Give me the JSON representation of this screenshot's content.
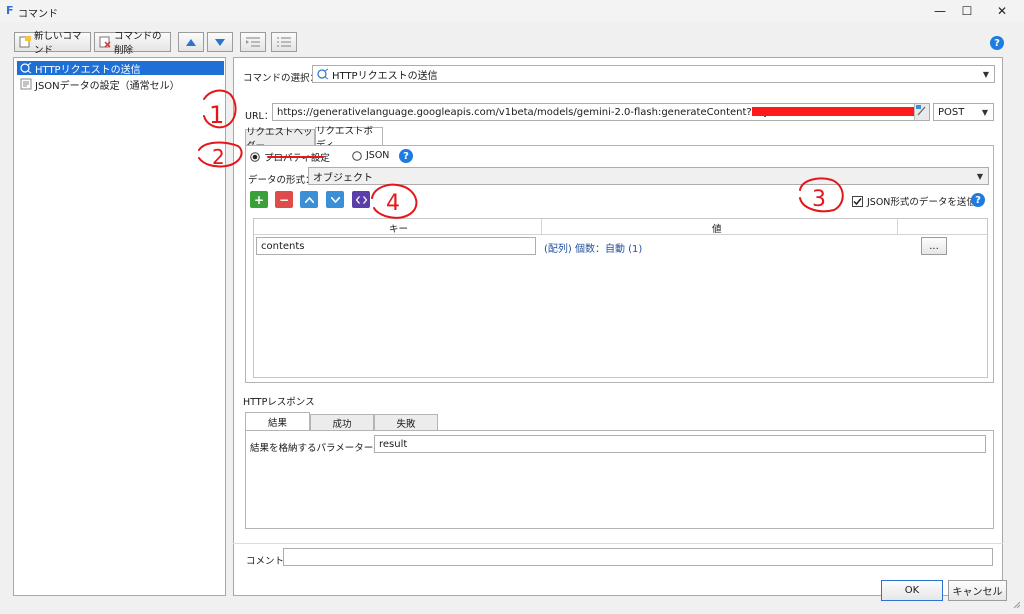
{
  "window": {
    "logo": "F",
    "title": "コマンド",
    "minimize": "—",
    "maximize": "☐",
    "close": "✕"
  },
  "toolbar": {
    "new_command": "新しいコマンド",
    "delete_command": "コマンドの削除",
    "up_icon": "triangle-up",
    "down_icon": "triangle-down",
    "help": "?"
  },
  "tree": {
    "items": [
      {
        "label": "HTTPリクエストの送信",
        "selected": true
      },
      {
        "label": "JSONデータの設定（通常セル）",
        "selected": false
      }
    ]
  },
  "command_select": {
    "label": "コマンドの選択：",
    "value": "HTTPリクエストの送信"
  },
  "url": {
    "label": "URL：",
    "value": "https://generativelanguage.googleapis.com/v1beta/models/gemini-2.0-flash:generateContent?key=",
    "method": "POST"
  },
  "request_tabs": [
    "リクエストヘッダー",
    "リクエストボディ"
  ],
  "body_mode": {
    "property": "プロパティ設定",
    "json": "JSON",
    "selected": "property"
  },
  "data_format": {
    "label": "データの形式：",
    "value": "オブジェクト"
  },
  "send_as_json": {
    "label": "JSON形式のデータを送信",
    "checked": true
  },
  "grid": {
    "headers": [
      "キー",
      "値"
    ],
    "rows": [
      {
        "key": "contents",
        "value": "(配列) 個数：自動 (1)",
        "button": "..."
      }
    ]
  },
  "response": {
    "section_label": "HTTPレスポンス",
    "tabs": [
      "結果",
      "成功",
      "失敗"
    ],
    "param_label": "結果を格納するパラメーター名：",
    "param_value": "result"
  },
  "comment": {
    "label": "コメント",
    "value": ""
  },
  "footer": {
    "ok": "OK",
    "cancel": "キャンセル"
  },
  "annotations": [
    "1",
    "2",
    "3",
    "4"
  ],
  "colors": {
    "selection": "#1e6fd6",
    "help": "#1e7be0",
    "add": "#3aa03a",
    "remove": "#dd4b4b",
    "move": "#3b8fd6",
    "code": "#5b3fa8",
    "annotation": "#e3171a",
    "redaction": "#ff1a1a"
  }
}
